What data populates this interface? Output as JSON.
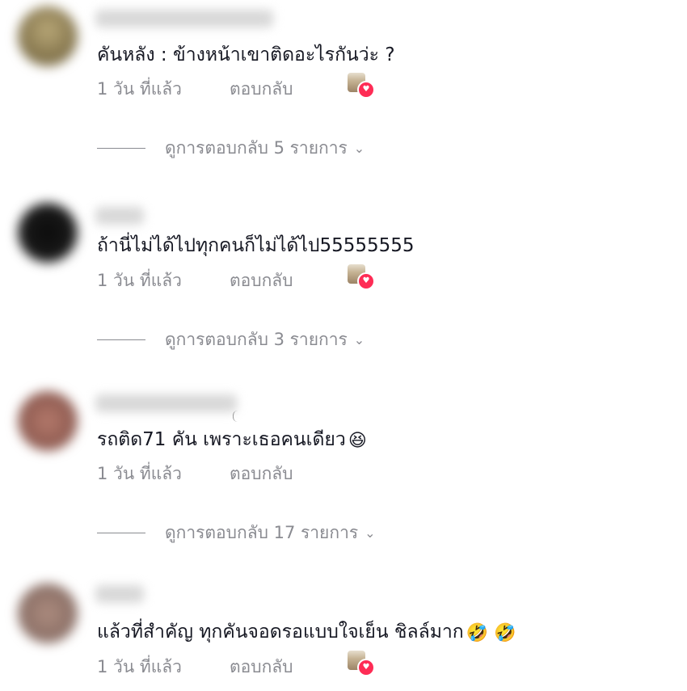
{
  "comments": [
    {
      "text": "คันหลัง : ข้างหน้าเขาติดอะไรกันว่ะ ?",
      "emoji": "",
      "time": "1 วัน ที่แล้ว",
      "reply_label": "ตอบกลับ",
      "liked_by_creator": true,
      "view_replies": "ดูการตอบกลับ 5 รายการ"
    },
    {
      "text": "ถ้านี่ไม่ได้ไปทุกคนก็ไม่ได้ไป55555555",
      "emoji": "",
      "time": "1 วัน ที่แล้ว",
      "reply_label": "ตอบกลับ",
      "liked_by_creator": true,
      "view_replies": "ดูการตอบกลับ 3 รายการ"
    },
    {
      "text": "รถติด71 คัน เพราะเธอคนเดียว",
      "emoji": "😆",
      "time": "1 วัน ที่แล้ว",
      "reply_label": "ตอบกลับ",
      "liked_by_creator": false,
      "view_replies": "ดูการตอบกลับ 17 รายการ"
    },
    {
      "text": "แล้วที่สำคัญ ทุกคันจอดรอแบบใจเย็น ชิลล์มาก",
      "emoji": "🤣 🤣",
      "time": "1 วัน ที่แล้ว",
      "reply_label": "ตอบกลับ",
      "liked_by_creator": true,
      "view_replies": ""
    }
  ],
  "icons": {
    "chevron": "chevron-down-icon",
    "heart_badge": "heart-icon"
  },
  "colors": {
    "text": "#161823",
    "muted": "#8a8b91",
    "heart": "#fe2c55"
  }
}
